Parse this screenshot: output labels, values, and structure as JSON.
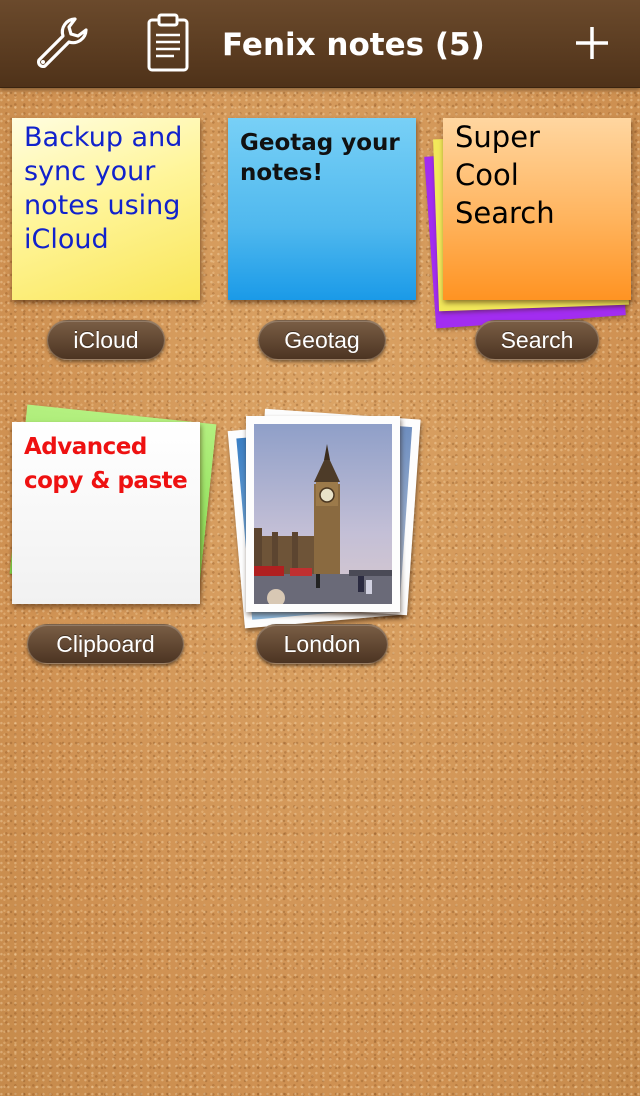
{
  "header": {
    "title": "Fenix notes (5)",
    "settings_icon": "wrench-icon",
    "clipboard_icon": "clipboard-icon",
    "add_icon": "plus-icon"
  },
  "notes": [
    {
      "label": "iCloud",
      "text": "Backup and sync your notes using iCloud",
      "color": "#fff59a",
      "text_color": "#1122cc"
    },
    {
      "label": "Geotag",
      "text": "Geotag your notes!",
      "color": "#4fb8ee",
      "text_color": "#111111"
    },
    {
      "label": "Search",
      "text": "Super Cool Search",
      "color": "#ffa53f",
      "text_color": "#000000"
    },
    {
      "label": "Clipboard",
      "text": "Advanced copy & paste",
      "color": "#f4f4f4",
      "text_color": "#ee1111"
    },
    {
      "label": "London",
      "type": "photo-stack"
    }
  ],
  "colors": {
    "topbar": "#5a3b20",
    "cork": "#d39a5c",
    "pill": "#5e4431"
  }
}
